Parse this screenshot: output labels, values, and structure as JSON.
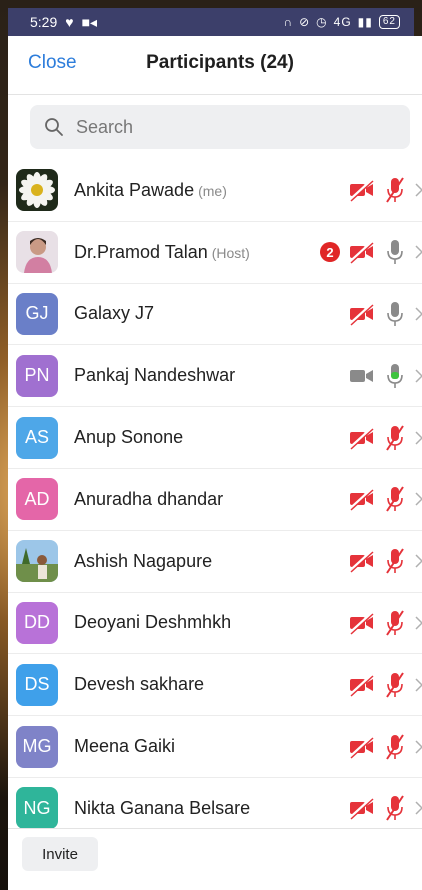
{
  "status_bar": {
    "time": "5:29",
    "network": "4G",
    "battery": "62"
  },
  "header": {
    "close_label": "Close",
    "title": "Participants (24)"
  },
  "search": {
    "placeholder": "Search"
  },
  "participants": [
    {
      "name": "Ankita Pawade",
      "tag": "(me)",
      "avatar_type": "photo-flower",
      "video": "off",
      "audio": "muted"
    },
    {
      "name": "Dr.Pramod Talan",
      "tag": "(Host)",
      "avatar_type": "photo-person",
      "badge": "2",
      "video": "off",
      "audio": "idle"
    },
    {
      "name": "Galaxy J7",
      "initials": "GJ",
      "avatar_color": "#6a7fc8",
      "video": "off",
      "audio": "idle"
    },
    {
      "name": "Pankaj Nandeshwar",
      "initials": "PN",
      "avatar_color": "#a070d0",
      "video": "on",
      "audio": "active"
    },
    {
      "name": "Anup Sonone",
      "initials": "AS",
      "avatar_color": "#4ea7e8",
      "video": "off",
      "audio": "muted"
    },
    {
      "name": "Anuradha dhandar",
      "initials": "AD",
      "avatar_color": "#e466a8",
      "video": "off",
      "audio": "muted"
    },
    {
      "name": "Ashish Nagapure",
      "avatar_type": "photo-outdoor",
      "video": "off",
      "audio": "muted"
    },
    {
      "name": "Deoyani Deshmhkh",
      "initials": "DD",
      "avatar_color": "#b872d8",
      "video": "off",
      "audio": "muted"
    },
    {
      "name": "Devesh sakhare",
      "initials": "DS",
      "avatar_color": "#3fa0ea",
      "video": "off",
      "audio": "muted"
    },
    {
      "name": "Meena Gaiki",
      "initials": "MG",
      "avatar_color": "#7f83c8",
      "video": "off",
      "audio": "muted"
    },
    {
      "name": "Nikta Ganana Belsare",
      "initials": "NG",
      "avatar_color": "#2fb59a",
      "video": "off",
      "audio": "muted"
    }
  ],
  "footer": {
    "invite_label": "Invite"
  },
  "colors": {
    "accent": "#2d7ddb",
    "muted_red": "#e5333a",
    "active_green": "#3ec43e",
    "badge_red": "#e02626"
  }
}
